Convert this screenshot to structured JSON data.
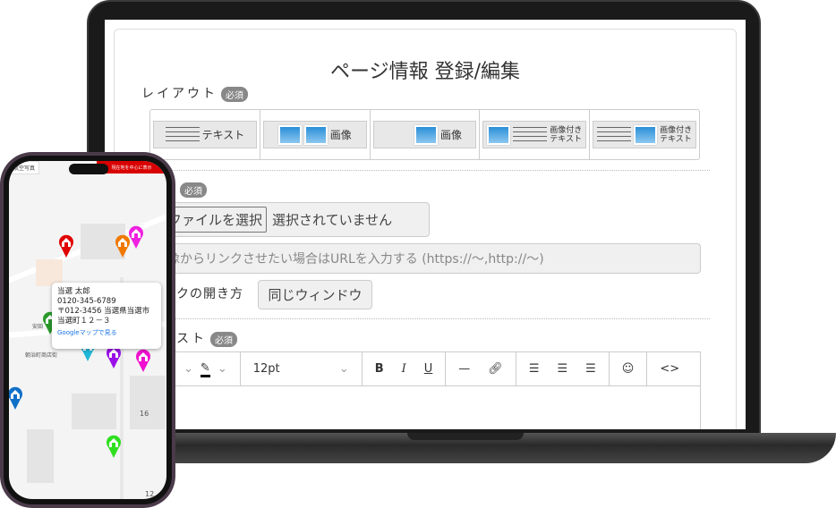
{
  "page": {
    "title": "ページ情報 登録/編集",
    "required_badge": "必須",
    "layout_label": "レイアウト",
    "layout_options": [
      {
        "label": "テキスト"
      },
      {
        "label": "画像"
      },
      {
        "label": "画像"
      },
      {
        "label_line1": "画像付き",
        "label_line2": "テキスト"
      },
      {
        "label_line1": "画像付き",
        "label_line2": "テキスト"
      }
    ],
    "file_button": "ファイルを選択",
    "file_status": "選択されていません",
    "url_placeholder": "像からリンクさせたい場合はURLを入力する (https://〜,http://〜)",
    "link_open_label": "クの開き方",
    "link_open_value": "同じウィンドウ",
    "text_label": "スト",
    "editor": {
      "font_size": "12pt"
    }
  },
  "phone_map": {
    "map_type_button": "航空写真",
    "current_location_button": "現在地を中心に表示",
    "popup": {
      "name": "当選 太郎",
      "phone": "0120-345-6789",
      "address1": "〒012-3456 当選県当選市",
      "address2": "当選町１２－３",
      "link": "Googleマップで見る"
    },
    "street_labels": [
      "安田",
      "朝治町商店街"
    ],
    "block_numbers": [
      "16",
      "12"
    ],
    "pin_colors": [
      "#e00000",
      "#f07800",
      "#f020e0",
      "#2a9a2a",
      "#20b8d8",
      "#9a10e8",
      "#f010d0",
      "#1070c8",
      "#30e020"
    ]
  }
}
